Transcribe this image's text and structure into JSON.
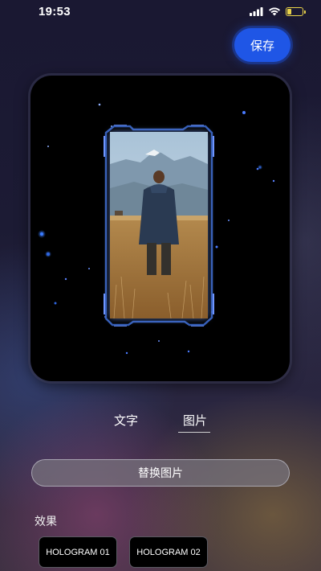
{
  "status_bar": {
    "time": "19:53",
    "icons": [
      "signal-icon",
      "wifi-icon",
      "battery-charging-icon"
    ],
    "battery_color": "#e8d24a"
  },
  "header": {
    "save_label": "保存",
    "save_color": "#1f56e6"
  },
  "preview": {
    "effect_style": "hologram frame with glowing blue particles",
    "image_subject": "person in jacket standing in golden grass field facing mountains"
  },
  "tabs": [
    {
      "label": "文字",
      "active": false
    },
    {
      "label": "图片",
      "active": true
    }
  ],
  "replace_button": {
    "label": "替换图片"
  },
  "effects": {
    "title": "效果",
    "items": [
      {
        "label": "HOLOGRAM 01"
      },
      {
        "label": "HOLOGRAM 02"
      }
    ]
  }
}
